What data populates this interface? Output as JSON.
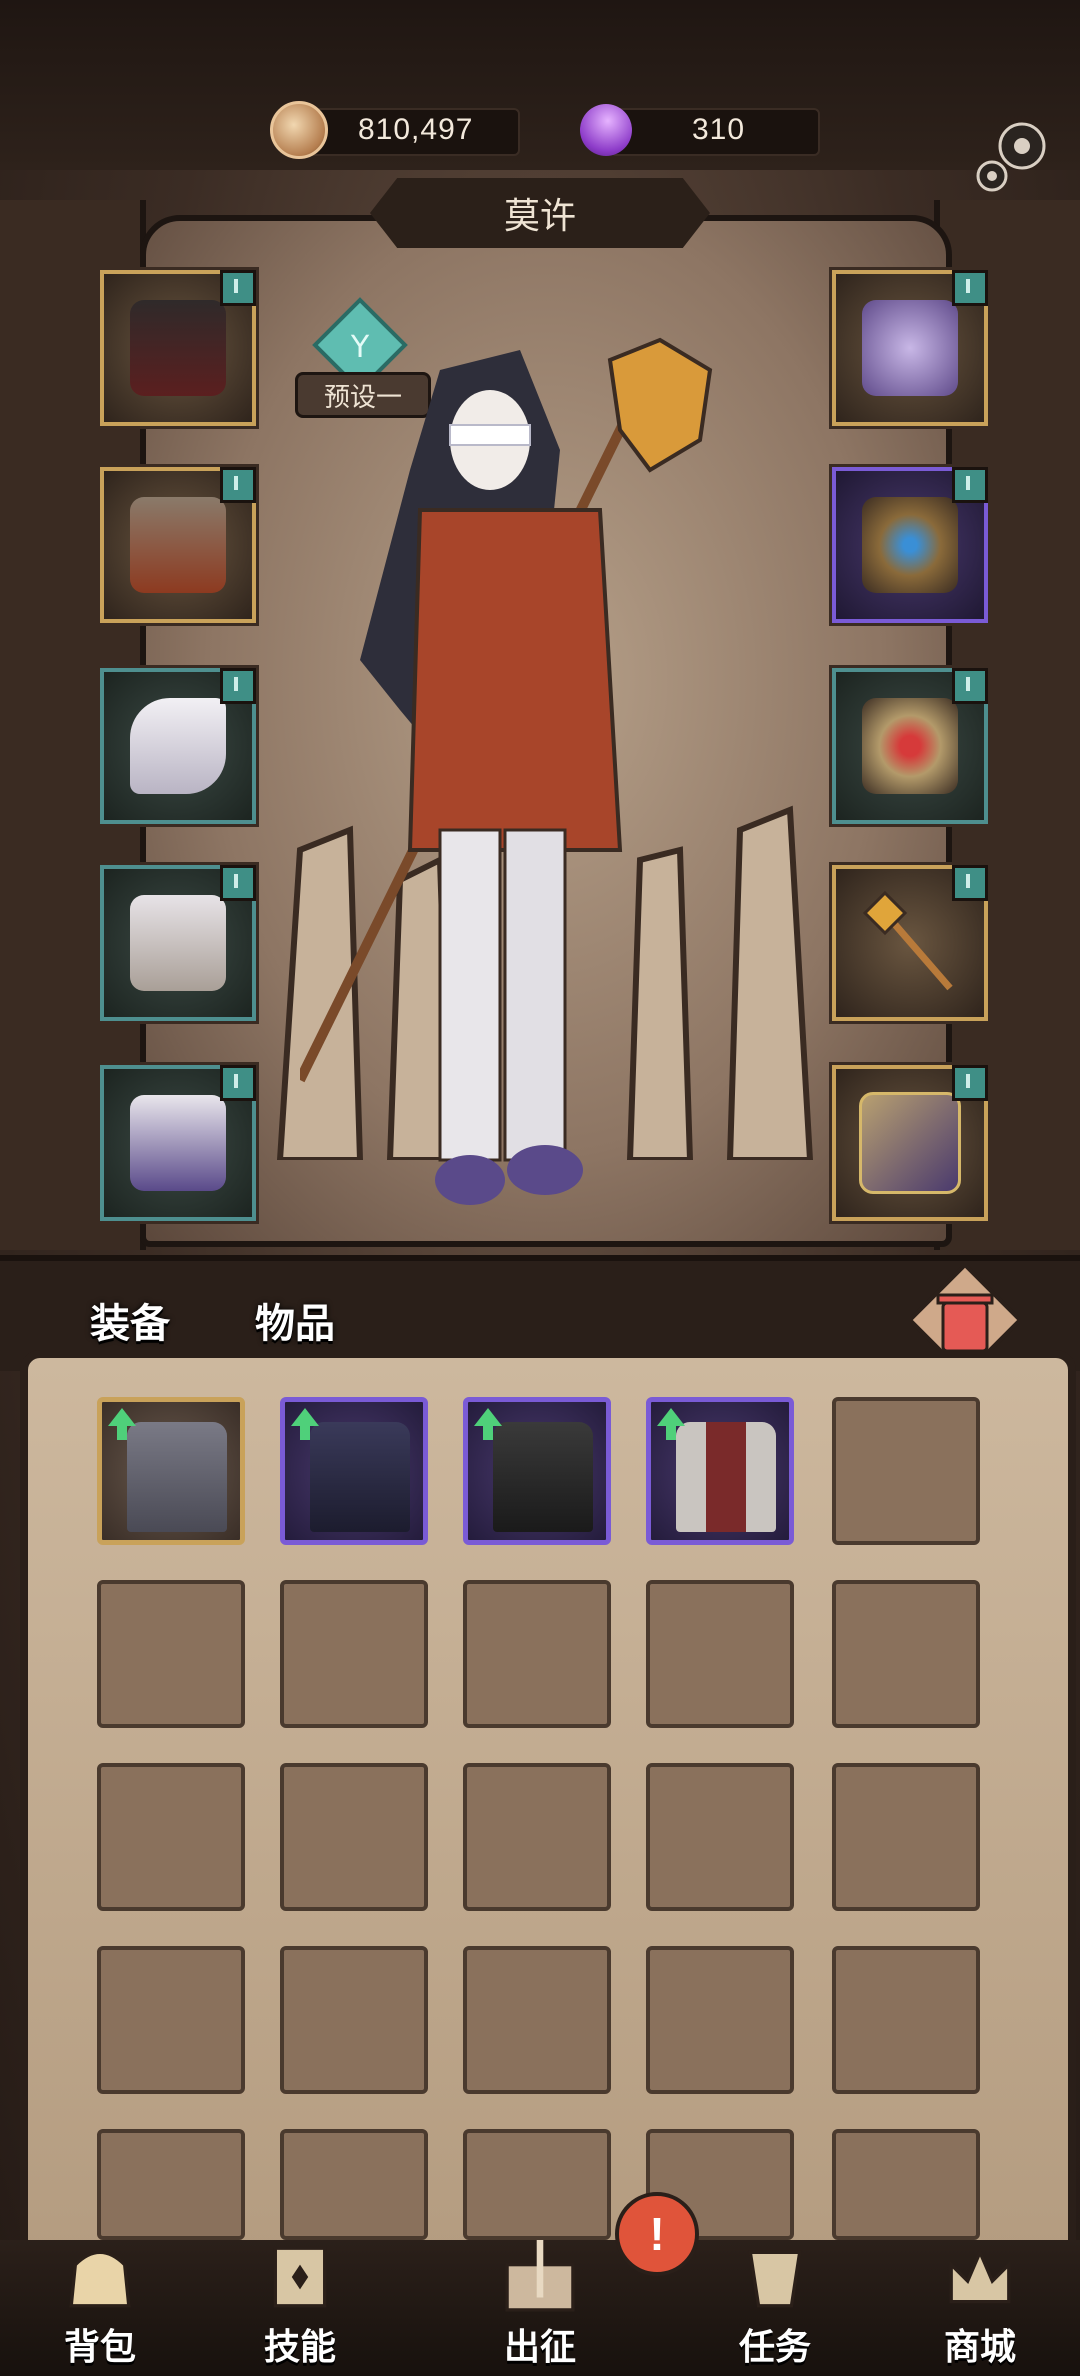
{
  "currency": {
    "coins": "810,497",
    "gems": "310"
  },
  "character": {
    "name": "莫许",
    "preset": "预设一"
  },
  "tabs": {
    "equip": "装备",
    "items": "物品"
  },
  "nav": [
    {
      "label": "背包",
      "icon": "backpack-icon"
    },
    {
      "label": "技能",
      "icon": "skill-icon"
    },
    {
      "label": "出征",
      "icon": "sword-map-icon"
    },
    {
      "label": "任务",
      "icon": "quest-scroll-icon"
    },
    {
      "label": "商城",
      "icon": "shop-crown-icon"
    }
  ],
  "alert": "!",
  "equip_left": [
    "hood",
    "fur-cape",
    "gloves",
    "pants",
    "boots"
  ],
  "equip_right": [
    "crystal-necklace",
    "dragon-ring",
    "ruby-amulet",
    "golden-staff",
    "spell-tome"
  ],
  "inventory": [
    "gray-pants",
    "dark-armor",
    "black-skirt",
    "red-vest"
  ]
}
